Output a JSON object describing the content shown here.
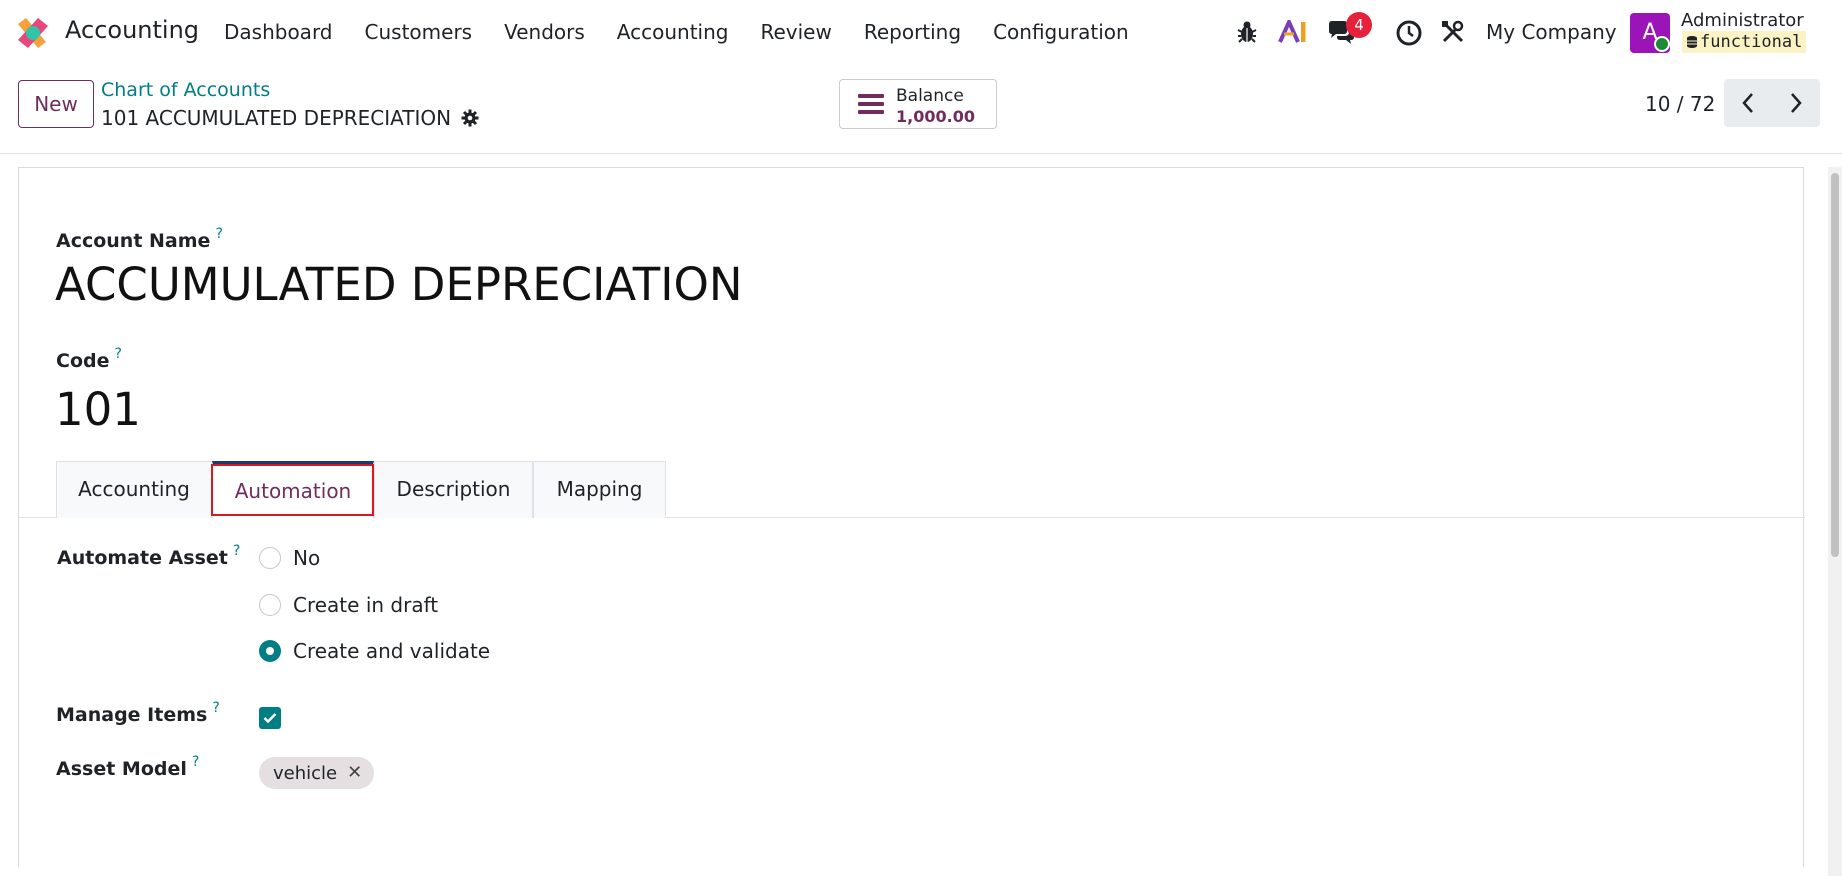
{
  "navbar": {
    "app_name": "Accounting",
    "menu": [
      "Dashboard",
      "Customers",
      "Vendors",
      "Accounting",
      "Review",
      "Reporting",
      "Configuration"
    ],
    "icons": [
      "bug-icon",
      "ai-icon",
      "chat-icon",
      "clock-icon",
      "tools-icon"
    ],
    "messages_count": "4",
    "company": "My Company",
    "avatar_letter": "A",
    "user_name": "Administrator",
    "database": "functional"
  },
  "control_panel": {
    "new_label": "New",
    "breadcrumb": "Chart of Accounts",
    "record_title": "101 ACCUMULATED DEPRECIATION",
    "balance_label": "Balance",
    "balance_value": "1,000.00",
    "pager_value": "10 / 72"
  },
  "form": {
    "account_name_label": "Account Name",
    "account_name": "ACCUMULATED DEPRECIATION",
    "code_label": "Code",
    "code": "101",
    "help_mark": "?",
    "tabs": [
      "Accounting",
      "Automation",
      "Description",
      "Mapping"
    ],
    "active_tab": "Automation",
    "automate_asset_label": "Automate Asset",
    "automate_options": [
      "No",
      "Create in draft",
      "Create and validate"
    ],
    "automate_selected": "Create and validate",
    "manage_items_label": "Manage Items",
    "manage_items_checked": true,
    "asset_model_label": "Asset Model",
    "asset_model_tag": "vehicle",
    "tag_remove": "✕"
  },
  "colors": {
    "brand": "#6f2d5e",
    "accent": "#017e84",
    "badge": "#e5213b",
    "highlight": "#d71920"
  }
}
